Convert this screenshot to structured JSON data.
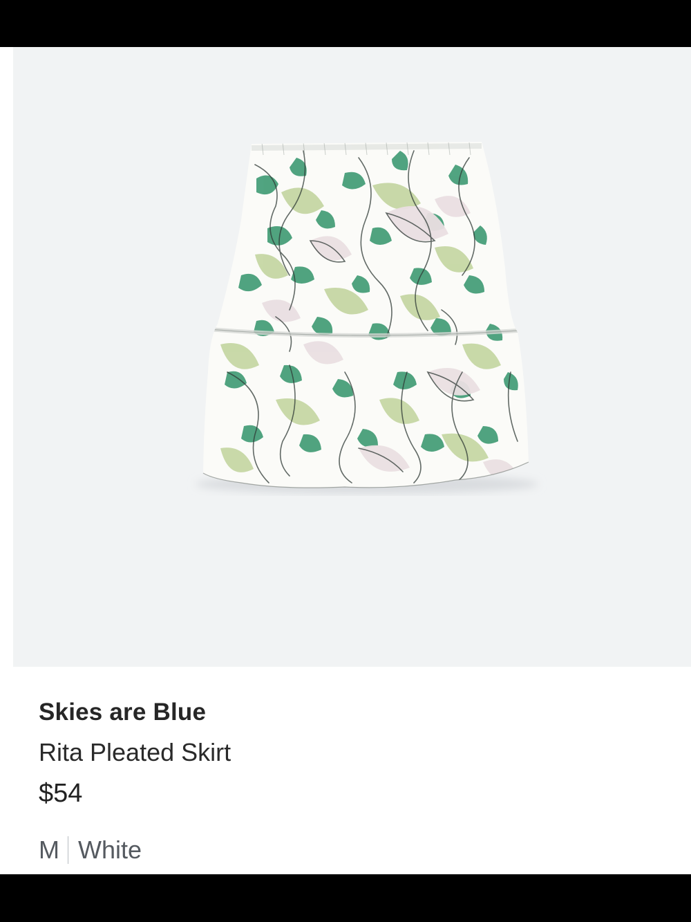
{
  "product": {
    "brand": "Skies are Blue",
    "name": "Rita Pleated Skirt",
    "price": "$54",
    "size": "M",
    "color": "White"
  },
  "palette": {
    "image_background": "#f1f3f4",
    "print_green": "#3e9a73",
    "print_sage": "#c6d7a4",
    "print_blush": "#eadfe2",
    "fabric_white": "#fbfbf8"
  }
}
